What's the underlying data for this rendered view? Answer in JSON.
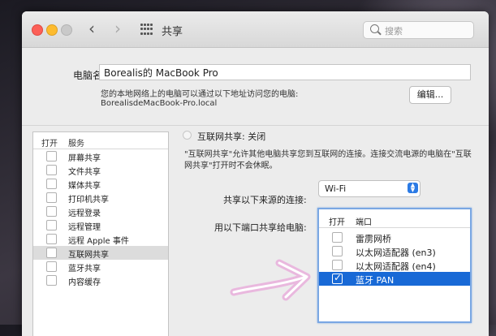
{
  "window": {
    "title": "共享"
  },
  "search": {
    "placeholder": "搜索"
  },
  "computer": {
    "label": "电脑名称:",
    "name": "Borealis的 MacBook Pro",
    "desc": "您的本地网络上的电脑可以通过以下地址访问您的电脑:",
    "address": "BorealisdeMacBook-Pro.local",
    "edit_label": "编辑..."
  },
  "services": {
    "col_on": "打开",
    "col_service": "服务",
    "items": [
      {
        "label": "屏幕共享",
        "on": false
      },
      {
        "label": "文件共享",
        "on": false
      },
      {
        "label": "媒体共享",
        "on": false
      },
      {
        "label": "打印机共享",
        "on": false
      },
      {
        "label": "远程登录",
        "on": false
      },
      {
        "label": "远程管理",
        "on": false
      },
      {
        "label": "远程 Apple 事件",
        "on": false
      },
      {
        "label": "互联网共享",
        "on": false,
        "selected": true
      },
      {
        "label": "蓝牙共享",
        "on": false
      },
      {
        "label": "内容缓存",
        "on": false
      }
    ]
  },
  "detail": {
    "status": "互联网共享: 关闭",
    "info_line1": "\"互联网共享\"允许其他电脑共享您到互联网的连接。连接交流电源的电脑在\"互联",
    "info_line2": "网共享\"打开时不会休眠。",
    "from_label": "共享以下来源的连接:",
    "from_value": "Wi-Fi",
    "to_label": "用以下端口共享给电脑:",
    "ports_col_on": "打开",
    "ports_col_port": "端口",
    "ports": [
      {
        "label": "雷雳网桥",
        "on": false
      },
      {
        "label": "以太网适配器 (en3)",
        "on": false
      },
      {
        "label": "以太网适配器 (en4)",
        "on": false
      },
      {
        "label": "蓝牙 PAN",
        "on": true,
        "selected": true
      }
    ]
  },
  "colors": {
    "selection_blue": "#1869d6",
    "close_red": "#fc5f57",
    "minimize_yellow": "#fdbb2e"
  },
  "icons": [
    "back-icon",
    "forward-icon",
    "grid-icon",
    "search-icon",
    "checkmark-icon",
    "hand-drawn-arrow-icon"
  ]
}
